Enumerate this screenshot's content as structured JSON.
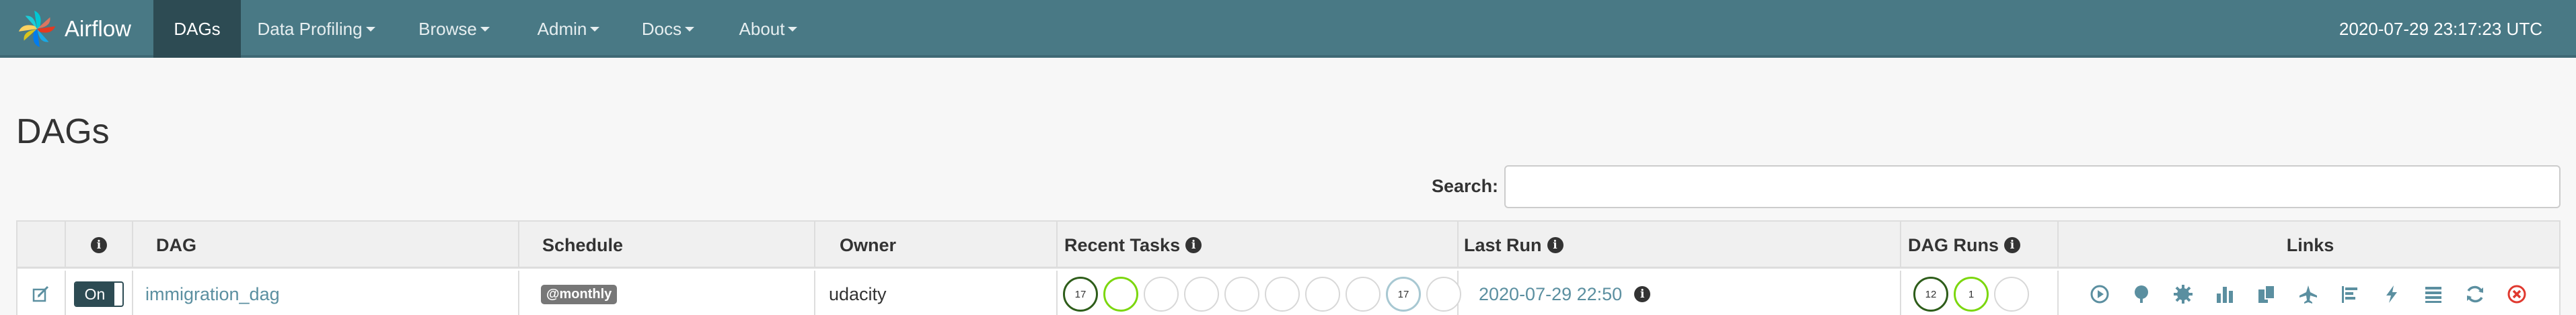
{
  "navbar": {
    "brand": "Airflow",
    "items": [
      {
        "label": "DAGs",
        "active": true,
        "caret": false
      },
      {
        "label": "Data Profiling",
        "active": false,
        "caret": true
      },
      {
        "label": "Browse",
        "active": false,
        "caret": true
      },
      {
        "label": "Admin",
        "active": false,
        "caret": true
      },
      {
        "label": "Docs",
        "active": false,
        "caret": true
      },
      {
        "label": "About",
        "active": false,
        "caret": true
      }
    ],
    "clock": "2020-07-29 23:17:23 UTC"
  },
  "page": {
    "title": "DAGs",
    "search": {
      "label": "Search:",
      "value": "",
      "placeholder": ""
    }
  },
  "table": {
    "headers": {
      "info": "i",
      "dag": "DAG",
      "schedule": "Schedule",
      "owner": "Owner",
      "recent_tasks": "Recent Tasks",
      "last_run": "Last Run",
      "dag_runs": "DAG Runs",
      "links": "Links"
    },
    "rows": [
      {
        "toggle": "On",
        "dag": "immigration_dag",
        "schedule": "@monthly",
        "owner": "udacity",
        "recent_tasks": [
          {
            "state": "success",
            "count": "17"
          },
          {
            "state": "running",
            "count": ""
          },
          {
            "state": "failed",
            "count": ""
          },
          {
            "state": "upstream_failed",
            "count": ""
          },
          {
            "state": "skipped",
            "count": ""
          },
          {
            "state": "up_for_retry",
            "count": ""
          },
          {
            "state": "up_for_reschedule",
            "count": ""
          },
          {
            "state": "queued",
            "count": ""
          },
          {
            "state": "none",
            "count": "17"
          },
          {
            "state": "scheduled",
            "count": ""
          }
        ],
        "last_run": "2020-07-29 22:50",
        "dag_runs": [
          {
            "state": "success",
            "count": "12"
          },
          {
            "state": "running",
            "count": "1"
          },
          {
            "state": "failed",
            "count": ""
          }
        ]
      }
    ]
  },
  "colors": {
    "navbar": "#497985",
    "nav_active": "#2d4b53",
    "link": "#5b8fa0",
    "success": "#2e5d1a",
    "running": "#7cd70f",
    "none": "#a8c8d2",
    "delete": "#e0392f"
  },
  "link_icons": [
    "trigger-dag-icon",
    "tree-view-icon",
    "graph-view-icon",
    "tasks-duration-icon",
    "task-tries-icon",
    "landing-times-icon",
    "gantt-icon",
    "code-view-icon",
    "logs-icon",
    "refresh-icon",
    "delete-dag-icon"
  ]
}
